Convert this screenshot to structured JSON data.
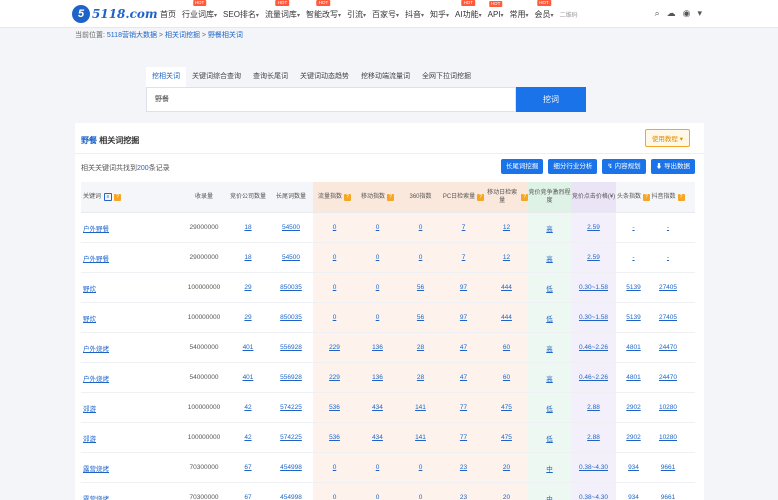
{
  "logo": {
    "mark": "5",
    "text": "5118.com"
  },
  "nav": [
    {
      "label": "首页",
      "hot": false,
      "caret": false
    },
    {
      "label": "行业词库",
      "hot": true,
      "caret": true
    },
    {
      "label": "SEO排名",
      "hot": false,
      "caret": true
    },
    {
      "label": "流量词库",
      "hot": true,
      "caret": true
    },
    {
      "label": "智能改写",
      "hot": true,
      "caret": true
    },
    {
      "label": "引流",
      "hot": false,
      "caret": true
    },
    {
      "label": "百家号",
      "hot": false,
      "caret": true
    },
    {
      "label": "抖音",
      "hot": false,
      "caret": true
    },
    {
      "label": "知乎",
      "hot": false,
      "caret": true
    },
    {
      "label": "AI功能",
      "hot": true,
      "caret": true
    },
    {
      "label": "API",
      "hot": true,
      "caret": true
    },
    {
      "label": "常用",
      "hot": false,
      "caret": true
    },
    {
      "label": "会员",
      "hot": true,
      "caret": true
    }
  ],
  "hot_label": "HOT",
  "nav_extra": "二维码",
  "top_icons": {
    "search": "⌕",
    "cloud": "☁",
    "user": "◉",
    "caret": "▾"
  },
  "breadcrumb": {
    "prefix": "当前位置:",
    "items": [
      "5118营销大数据",
      "相关词挖掘",
      "野餐相关词"
    ],
    "sep": " > "
  },
  "tabs": [
    "挖相关词",
    "关键词综合查询",
    "查询长尾词",
    "关键词动态趋势",
    "挖移动端流量词",
    "全网下拉词挖掘"
  ],
  "search": {
    "value": "野餐",
    "button": "挖词"
  },
  "section": {
    "keyword": "野餐",
    "title": "相关词挖掘",
    "tutorial": "使用教程 ▾"
  },
  "summary": {
    "prefix": "相关关键词共找到",
    "count": "200",
    "suffix": "条记录"
  },
  "actions": [
    "长尾词挖掘",
    "细分行业分析",
    "↯ 内容规划",
    "⬇ 导出数据"
  ],
  "columns": [
    "关键词",
    "收录量",
    "竞价公司数量",
    "长尾词数量",
    "流量指数",
    "移动指数",
    "360指数",
    "PC日检索量",
    "移动日检索量",
    "竞价竞争激烈程度",
    "竞价点击价格(¥)",
    "头条指数",
    "抖音指数"
  ],
  "rows": [
    [
      "户外野餐",
      "29000000",
      "18",
      "54500",
      "0",
      "0",
      "0",
      "7",
      "12",
      "高",
      "2.59",
      "-",
      "-"
    ],
    [
      "户外野餐",
      "29000000",
      "18",
      "54500",
      "0",
      "0",
      "0",
      "7",
      "12",
      "高",
      "2.59",
      "-",
      "-"
    ],
    [
      "野炊",
      "100000000",
      "29",
      "850035",
      "0",
      "0",
      "56",
      "97",
      "444",
      "低",
      "0.30~1.58",
      "5139",
      "27405"
    ],
    [
      "野炊",
      "100000000",
      "29",
      "850035",
      "0",
      "0",
      "56",
      "97",
      "444",
      "低",
      "0.30~1.58",
      "5139",
      "27405"
    ],
    [
      "户外烧烤",
      "54000000",
      "401",
      "556928",
      "229",
      "136",
      "28",
      "47",
      "60",
      "高",
      "0.46~2.26",
      "4801",
      "24470"
    ],
    [
      "户外烧烤",
      "54000000",
      "401",
      "556928",
      "229",
      "136",
      "28",
      "47",
      "60",
      "高",
      "0.46~2.26",
      "4801",
      "24470"
    ],
    [
      "郊游",
      "100000000",
      "42",
      "574225",
      "536",
      "434",
      "141",
      "77",
      "475",
      "低",
      "2.88",
      "2902",
      "10280"
    ],
    [
      "郊游",
      "100000000",
      "42",
      "574225",
      "536",
      "434",
      "141",
      "77",
      "475",
      "低",
      "2.88",
      "2902",
      "10280"
    ],
    [
      "露营烧烤",
      "70300000",
      "67",
      "454998",
      "0",
      "0",
      "0",
      "23",
      "20",
      "中",
      "0.38~4.30",
      "934",
      "9661"
    ],
    [
      "露营烧烤",
      "70300000",
      "67",
      "454998",
      "0",
      "0",
      "0",
      "23",
      "20",
      "中",
      "0.38~4.30",
      "934",
      "9661"
    ]
  ],
  "colors": {
    "accent": "#1a73e8",
    "link": "#1e64c8",
    "hot": "#ff5a3c",
    "tutorial": "#f5a623"
  }
}
